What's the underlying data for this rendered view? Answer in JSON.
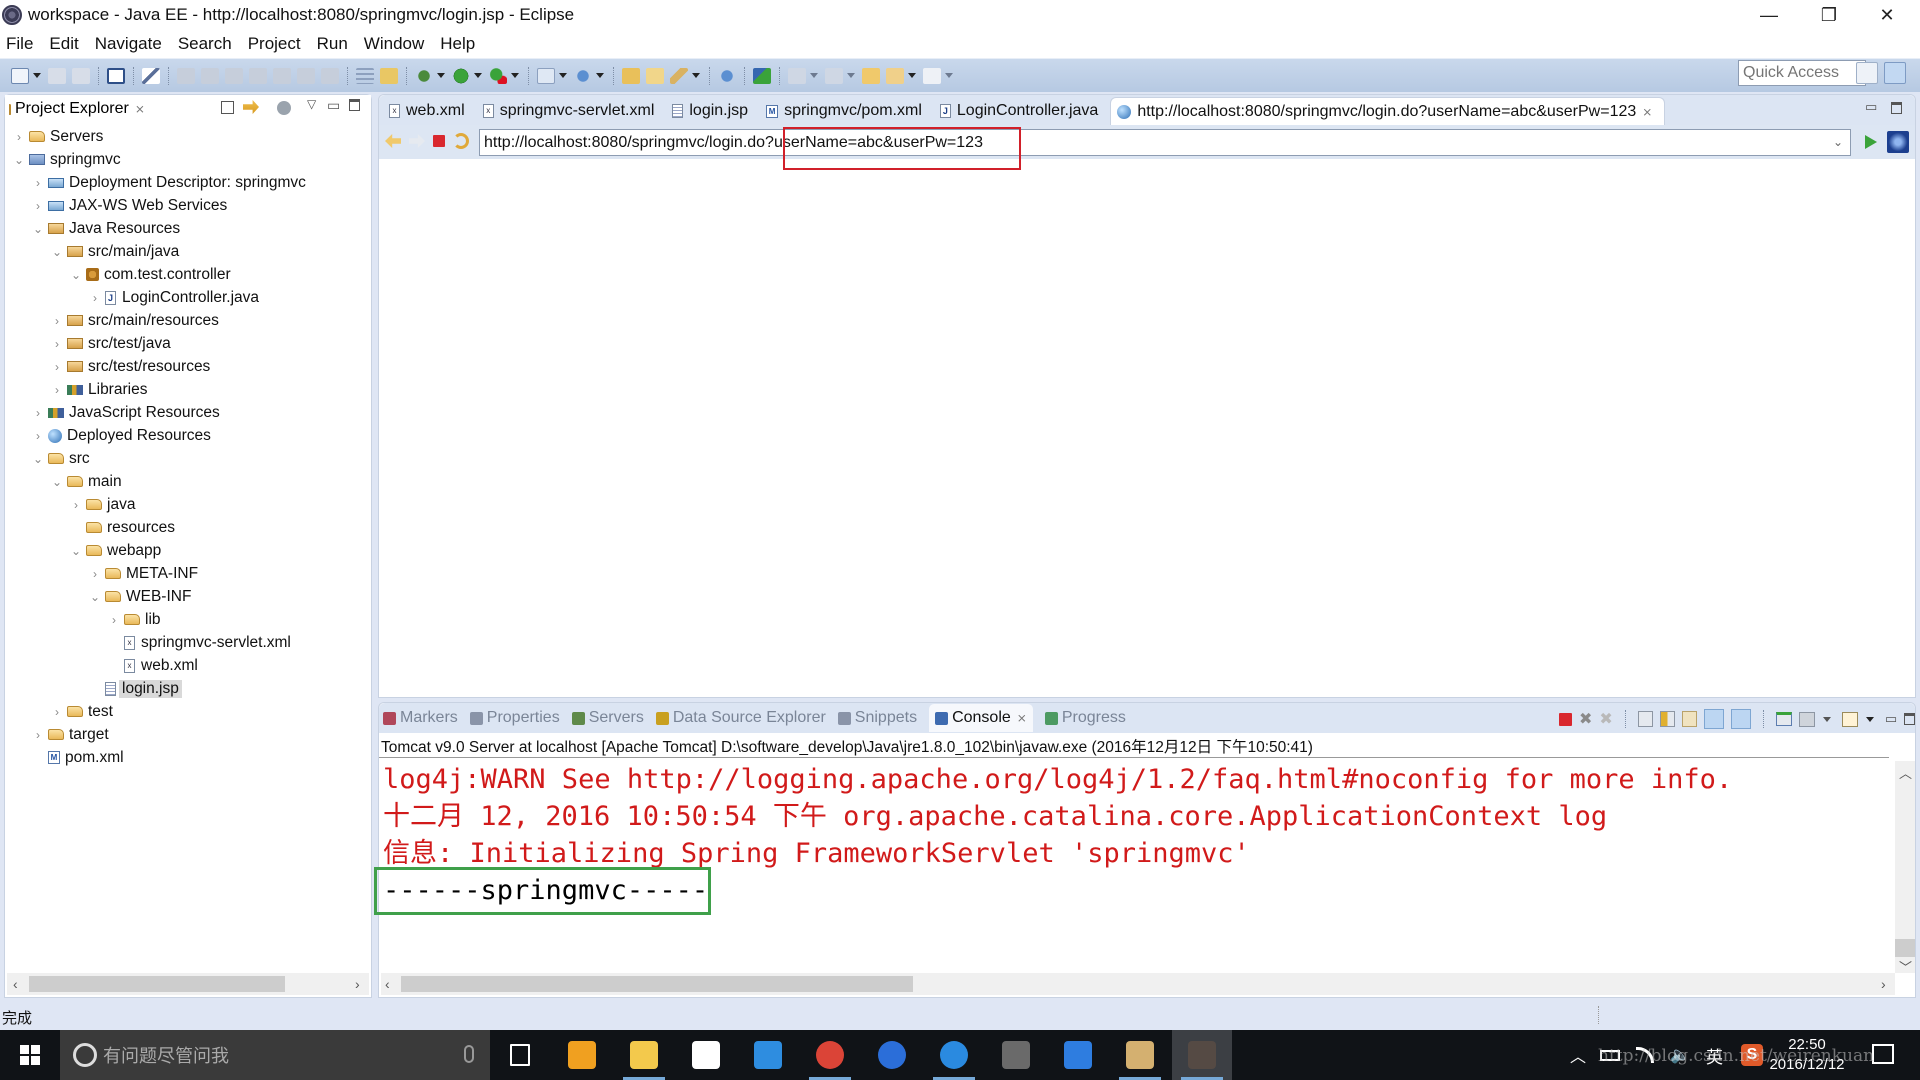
{
  "window": {
    "title": "workspace - Java EE - http://localhost:8080/springmvc/login.jsp - Eclipse",
    "controls": {
      "minimize": "—",
      "restore": "❐",
      "close": "✕"
    }
  },
  "menu": [
    "File",
    "Edit",
    "Navigate",
    "Search",
    "Project",
    "Run",
    "Window",
    "Help"
  ],
  "toolbar": {
    "quick_access_placeholder": "Quick Access"
  },
  "explorer": {
    "title": "Project Explorer",
    "tree": [
      {
        "label": "Servers",
        "depth": 0,
        "arrow": "›",
        "icon": "folder"
      },
      {
        "label": "springmvc",
        "depth": 0,
        "arrow": "⌄",
        "icon": "project"
      },
      {
        "label": "Deployment Descriptor: springmvc",
        "depth": 1,
        "arrow": "›",
        "icon": "server"
      },
      {
        "label": "JAX-WS Web Services",
        "depth": 1,
        "arrow": "›",
        "icon": "server"
      },
      {
        "label": "Java Resources",
        "depth": 1,
        "arrow": "⌄",
        "icon": "pkgfolder"
      },
      {
        "label": "src/main/java",
        "depth": 2,
        "arrow": "⌄",
        "icon": "pkgfolder"
      },
      {
        "label": "com.test.controller",
        "depth": 3,
        "arrow": "⌄",
        "icon": "pkg"
      },
      {
        "label": "LoginController.java",
        "depth": 4,
        "arrow": "›",
        "icon": "java"
      },
      {
        "label": "src/main/resources",
        "depth": 2,
        "arrow": "›",
        "icon": "pkgfolder"
      },
      {
        "label": "src/test/java",
        "depth": 2,
        "arrow": "›",
        "icon": "pkgfolder"
      },
      {
        "label": "src/test/resources",
        "depth": 2,
        "arrow": "›",
        "icon": "pkgfolder"
      },
      {
        "label": "Libraries",
        "depth": 2,
        "arrow": "›",
        "icon": "lib"
      },
      {
        "label": "JavaScript Resources",
        "depth": 1,
        "arrow": "›",
        "icon": "lib"
      },
      {
        "label": "Deployed Resources",
        "depth": 1,
        "arrow": "›",
        "icon": "globe"
      },
      {
        "label": "src",
        "depth": 1,
        "arrow": "⌄",
        "icon": "folder"
      },
      {
        "label": "main",
        "depth": 2,
        "arrow": "⌄",
        "icon": "folder"
      },
      {
        "label": "java",
        "depth": 3,
        "arrow": "›",
        "icon": "folder"
      },
      {
        "label": "resources",
        "depth": 3,
        "arrow": "",
        "icon": "folder"
      },
      {
        "label": "webapp",
        "depth": 3,
        "arrow": "⌄",
        "icon": "folder"
      },
      {
        "label": "META-INF",
        "depth": 4,
        "arrow": "›",
        "icon": "folder"
      },
      {
        "label": "WEB-INF",
        "depth": 4,
        "arrow": "⌄",
        "icon": "folder"
      },
      {
        "label": "lib",
        "depth": 5,
        "arrow": "›",
        "icon": "folder"
      },
      {
        "label": "springmvc-servlet.xml",
        "depth": 5,
        "arrow": "",
        "icon": "xml"
      },
      {
        "label": "web.xml",
        "depth": 5,
        "arrow": "",
        "icon": "xml"
      },
      {
        "label": "login.jsp",
        "depth": 4,
        "arrow": "",
        "icon": "jsp",
        "selected": true
      },
      {
        "label": "test",
        "depth": 2,
        "arrow": "›",
        "icon": "folder"
      },
      {
        "label": "target",
        "depth": 1,
        "arrow": "›",
        "icon": "folder"
      },
      {
        "label": "pom.xml",
        "depth": 1,
        "arrow": "",
        "icon": "maven"
      }
    ]
  },
  "editor": {
    "tabs": [
      {
        "label": "web.xml",
        "icon": "xml"
      },
      {
        "label": "springmvc-servlet.xml",
        "icon": "xml"
      },
      {
        "label": "login.jsp",
        "icon": "jsp"
      },
      {
        "label": "springmvc/pom.xml",
        "icon": "maven"
      },
      {
        "label": "LoginController.java",
        "icon": "java"
      },
      {
        "label": "http://localhost:8080/springmvc/login.do?userName=abc&userPw=123",
        "icon": "globe",
        "active": true
      }
    ],
    "url": "http://localhost:8080/springmvc/login.do?userName=abc&userPw=123"
  },
  "console": {
    "tabs": [
      {
        "label": "Markers",
        "color": "#b0475a"
      },
      {
        "label": "Properties",
        "color": "#8a94a8"
      },
      {
        "label": "Servers",
        "color": "#5f8a4a"
      },
      {
        "label": "Data Source Explorer",
        "color": "#c9a020"
      },
      {
        "label": "Snippets",
        "color": "#8a94a8"
      },
      {
        "label": "Console",
        "color": "#3e6bb0",
        "active": true
      },
      {
        "label": "Progress",
        "color": "#4c9a62"
      }
    ],
    "process": "Tomcat v9.0 Server at localhost [Apache Tomcat] D:\\software_develop\\Java\\jre1.8.0_102\\bin\\javaw.exe (2016年12月12日 下午10:50:41)",
    "lines": [
      {
        "text": "log4j:WARN See http://logging.apache.org/log4j/1.2/faq.html#noconfig for more info.",
        "stream": "err"
      },
      {
        "text": "十二月 12, 2016 10:50:54 下午 org.apache.catalina.core.ApplicationContext log",
        "stream": "err"
      },
      {
        "text": "信息: Initializing Spring FrameworkServlet 'springmvc'",
        "stream": "err"
      },
      {
        "text": "------springmvc-----",
        "stream": "out"
      }
    ],
    "colors": {
      "stderr": "#d11a1a",
      "stdout": "#000000"
    }
  },
  "status": {
    "text": "完成"
  },
  "taskbar": {
    "search_placeholder": "有问题尽管问我",
    "apps": [
      {
        "name": "task-view",
        "color": "#ffffff"
      },
      {
        "name": "kugou-music",
        "color": "#f0a020"
      },
      {
        "name": "file-explorer",
        "color": "#f3c94c",
        "running": true
      },
      {
        "name": "store",
        "color": "#ffffff"
      },
      {
        "name": "app-blue",
        "color": "#2e8de0"
      },
      {
        "name": "chrome",
        "color": "#db4437",
        "running": true
      },
      {
        "name": "sogou-browser",
        "color": "#2b6ed9"
      },
      {
        "name": "internet-explorer",
        "color": "#2a8ae0",
        "running": true
      },
      {
        "name": "sublime-text",
        "color": "#6a6a6a"
      },
      {
        "name": "feishu-bird",
        "color": "#2e7de0"
      },
      {
        "name": "paint",
        "color": "#d4b070",
        "running": true
      },
      {
        "name": "eclipse-javaee",
        "color": "#554a44",
        "running": true,
        "active": true
      }
    ],
    "tray": {
      "ime": "英",
      "time": "22:50",
      "date": "2016/12/12"
    },
    "watermark": "http://blog.csdn.net/weirenkuan"
  },
  "annotations": {
    "red_box": "?userName=abc&userPw=123",
    "green_box": "------springmvc-----"
  }
}
